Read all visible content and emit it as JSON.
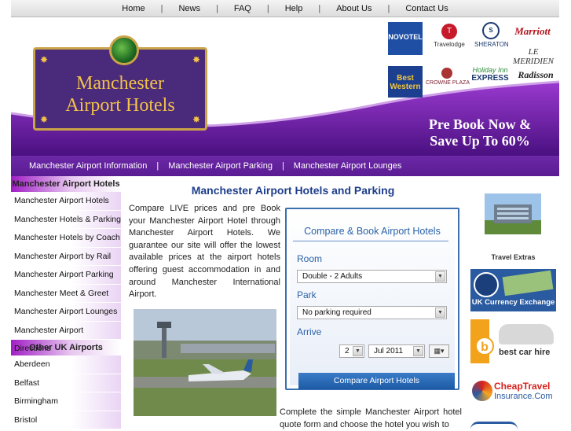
{
  "top_nav": {
    "items": [
      "Home",
      "News",
      "FAQ",
      "Help",
      "About Us",
      "Contact Us"
    ],
    "separator": "|"
  },
  "header": {
    "logo_line1": "Manchester",
    "logo_line2": "Airport Hotels",
    "promo_line1": "Pre Book Now &",
    "promo_line2": "Save Up To 60%",
    "brands": {
      "novotel": "NOVOTEL",
      "travelodge": "Travelodge",
      "sheraton": "SHERATON",
      "marriott": "Marriott",
      "meridien": "LE MERIDIEN",
      "bestwestern": "Best Western",
      "crowne": "CROWNE PLAZA",
      "holiday1": "Holiday Inn",
      "holiday2": "EXPRESS",
      "radisson": "Radisson"
    }
  },
  "sub_nav": {
    "items": [
      "Manchester Airport Information",
      "Manchester Airport Parking",
      "Manchester Airport Lounges"
    ],
    "separator": "|"
  },
  "sidebar": {
    "heading1": "Manchester Airport Hotels",
    "items1": [
      "Manchester Airport Hotels",
      "Manchester Hotels & Parking",
      "Manchester Hotels by Coach",
      "Manchester Airport by Rail",
      "Manchester Airport Parking",
      "Manchester Meet & Greet",
      "Manchester Airport Lounges",
      "Manchester Airport Directions"
    ],
    "heading2": "Other UK Airports",
    "items2": [
      "Aberdeen",
      "Belfast",
      "Birmingham",
      "Bristol"
    ]
  },
  "main": {
    "title": "Manchester Airport Hotels and Parking",
    "intro": "Compare LIVE prices and pre Book your Manchester Airport Hotel through Manchester Airport Hotels. We guarantee our site will offer the lowest available prices at the airport hotels offering guest accommodation in and around Manchester International Airport.",
    "bottom_text": "Complete the simple Manchester Airport hotel quote form and choose the hotel you wish to"
  },
  "booking": {
    "title": "Compare & Book Airport Hotels",
    "room_label": "Room",
    "room_value": "Double - 2 Adults",
    "parking_label": "Park",
    "parking_value": "No parking required",
    "arrive_label": "Arrive",
    "arrive_day": "2",
    "arrive_month": "Jul 2011",
    "button": "Compare Airport Hotels"
  },
  "right": {
    "extras_title": "Travel Extras",
    "currency": "UK Currency Exchange",
    "carhire": "best car hire",
    "cheap1": "CheapTravel",
    "cheap2": "Insurance.Com"
  },
  "colors": {
    "purple": "#5a1c93",
    "blue_title": "#1e3e8c",
    "accent_gold": "#f2c24a",
    "button_blue": "#1c5aa5"
  }
}
